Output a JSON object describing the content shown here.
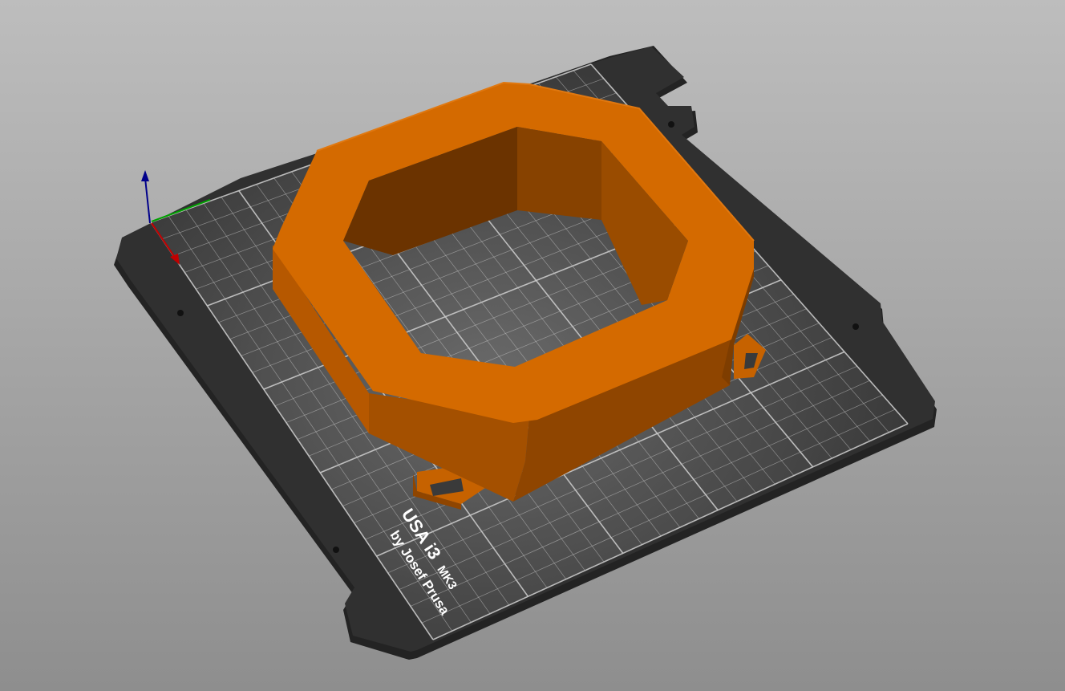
{
  "viewport": {
    "name": "3D view",
    "background_top": "#bdbdbd",
    "background_bottom": "#8e8e8e"
  },
  "bed": {
    "plate_color": "#2e2e2e",
    "grid_color": "#bfbfbf",
    "label_line1": "USA i3",
    "label_line1_suffix": "MK3",
    "label_line2": "by Josef Prusa"
  },
  "model": {
    "shape": "octagonal ring with mounting tabs",
    "colors": {
      "top": "#d46a00",
      "outer_side": "#b65800",
      "outer_side_dark": "#8f4500",
      "inner_wall_light": "#9a4c00",
      "inner_wall_dark": "#6b3300"
    }
  },
  "axes": {
    "x_color": "#c00000",
    "y_color": "#00a000",
    "z_color": "#00008b"
  }
}
